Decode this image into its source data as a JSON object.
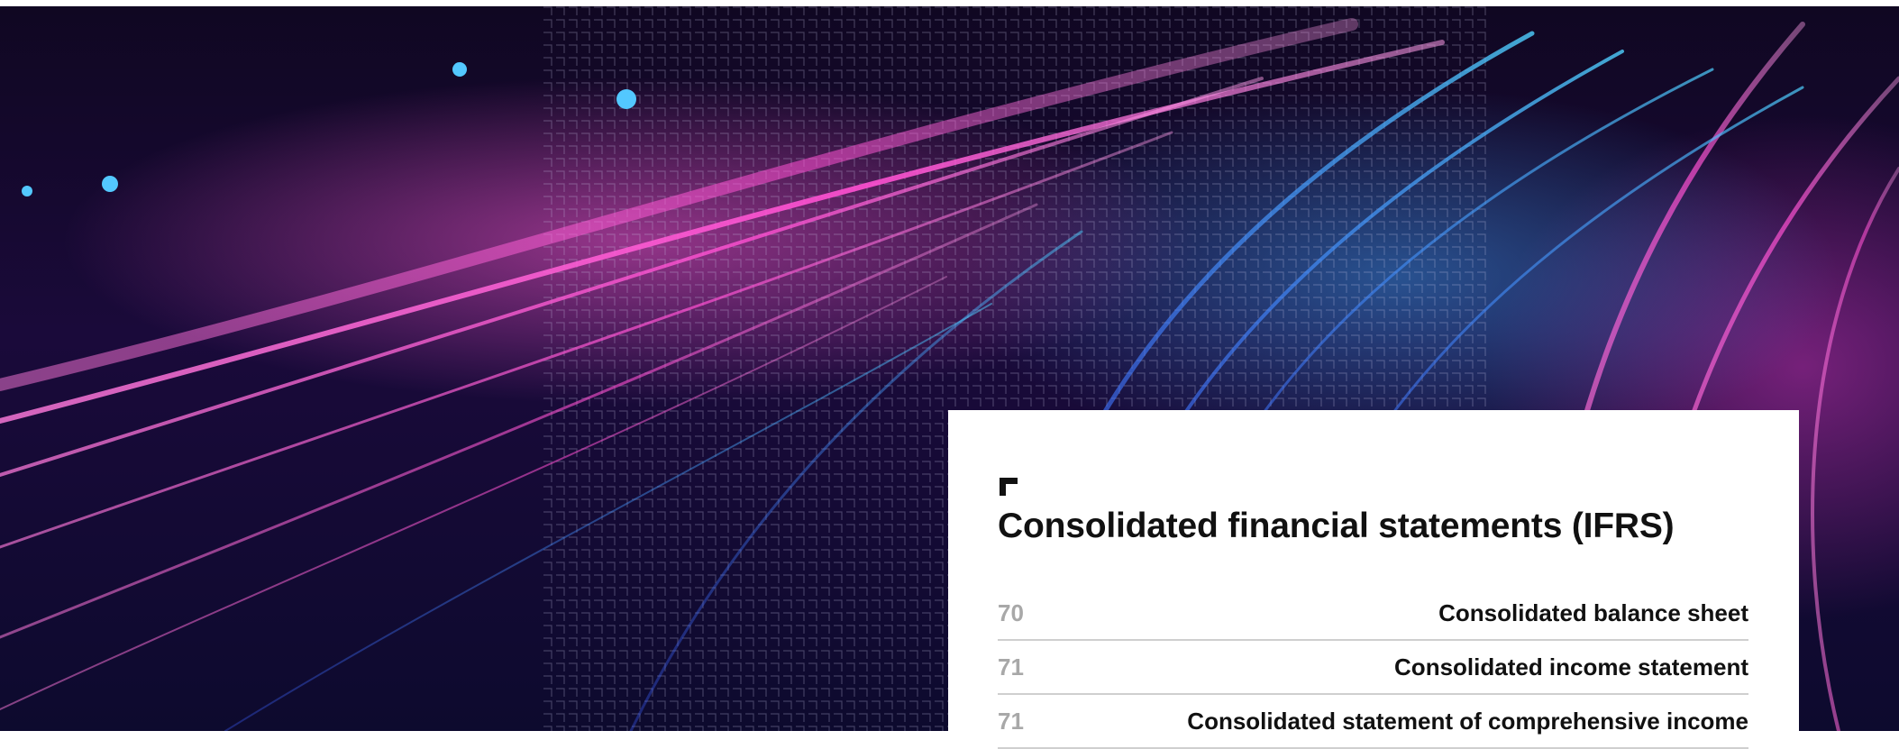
{
  "section": {
    "title": "Consolidated financial statements (IFRS)",
    "mark_icon": "corner-bracket-icon"
  },
  "toc": [
    {
      "page": "70",
      "label": "Consolidated balance sheet"
    },
    {
      "page": "71",
      "label": "Consolidated income statement"
    },
    {
      "page": "71",
      "label": "Consolidated statement of comprehensive income"
    }
  ],
  "hero": {
    "description_colors": {
      "magenta": "#ff4fd2",
      "blue": "#3aa8ff",
      "navy": "#120a30"
    }
  }
}
